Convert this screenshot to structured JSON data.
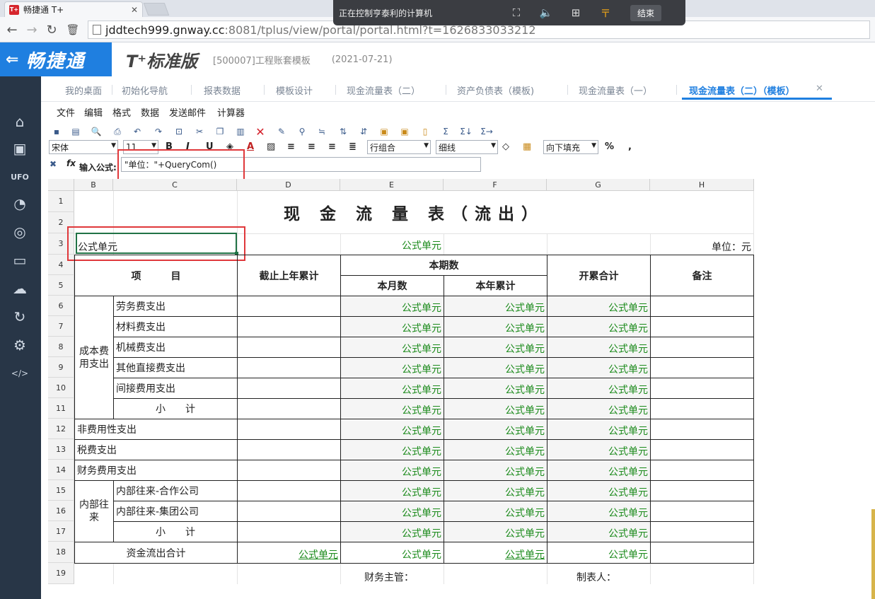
{
  "browser": {
    "tab_title": "畅捷通 T+",
    "tab_icon": "T+",
    "url_host": "jddtech999.gnway.cc",
    "url_rest": ":8081/tplus/view/portal/portal.html?t=1626833033212"
  },
  "remote_bar": {
    "text": "正在控制亨泰利的计算机",
    "end_label": "结束"
  },
  "app": {
    "logo_text": "畅捷通",
    "product": "T⁺标准版",
    "account": "[500007]工程账套模板",
    "date": "(2021-07-21)"
  },
  "nav_tabs": [
    "我的桌面",
    "初始化导航",
    "报表数据",
    "模板设计",
    "现金流量表（二）",
    "资产负债表（模板)",
    "现金流量表（一）",
    "现金流量表（二）（模板）"
  ],
  "menu": [
    "文件",
    "编辑",
    "格式",
    "数据",
    "发送邮件",
    "计算器"
  ],
  "toolbar": {
    "font": "宋体",
    "size": "11",
    "combine": "行组合",
    "line": "细线",
    "fill": "向下填充",
    "percent": "%",
    "comma": ","
  },
  "formula_bar": {
    "label": "输入公式:",
    "value": "\"单位：\"+QueryCom()"
  },
  "columns": [
    "B",
    "C",
    "D",
    "E",
    "F",
    "G",
    "H"
  ],
  "rows": [
    "1",
    "2",
    "3",
    "4",
    "5",
    "6",
    "7",
    "8",
    "9",
    "10",
    "11",
    "12",
    "13",
    "14",
    "15",
    "16",
    "17",
    "18",
    "19"
  ],
  "report": {
    "title": "现 金 流 量 表（流出）",
    "c3": "公式单元",
    "e3": "公式单元",
    "h3": "单位：元",
    "h_item": "项　　　目",
    "h_prev": "截止上年累计",
    "h_period": "本期数",
    "h_month": "本月数",
    "h_year": "本年累计",
    "h_total": "开累合计",
    "h_note": "备注",
    "group_cost": "成本费\n用支出",
    "group_internal": "内部往\n来",
    "items": [
      "劳务费支出",
      "材料费支出",
      "机械费支出",
      "其他直接费支出",
      "间接费用支出",
      "小　　计",
      "非费用性支出",
      "税费支出",
      "财务费用支出",
      "内部往来-合作公司",
      "内部往来-集团公司",
      "小　　计",
      "资金流出合计"
    ],
    "formula_text": "公式单元",
    "footer_fin": "财务主管：",
    "footer_maker": "制表人："
  }
}
